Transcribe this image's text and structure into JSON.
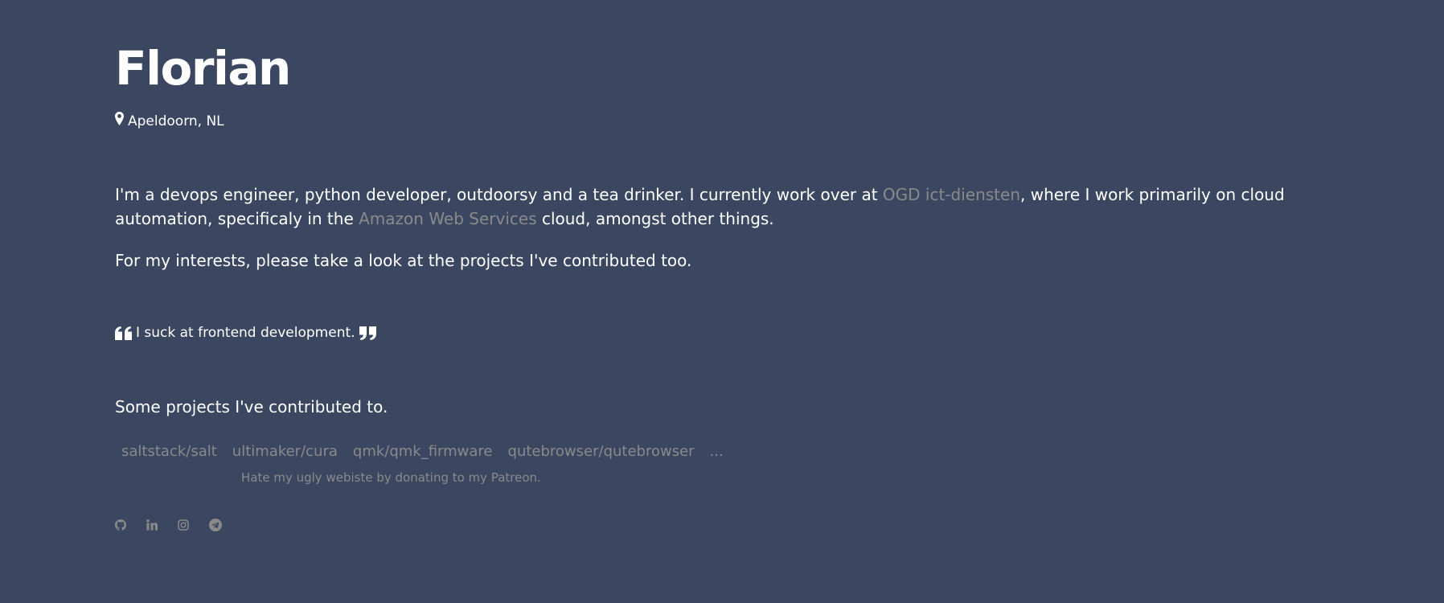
{
  "profile": {
    "name": "Florian",
    "location": "Apeldoorn, NL"
  },
  "intro": {
    "part1": "I'm a devops engineer, python developer, outdoorsy and a tea drinker. I currently work over at ",
    "employer_link": "OGD ict-diensten",
    "part2": ", where I work primarily on cloud automation, specificaly in the ",
    "cloud_link": "Amazon Web Services",
    "part3": " cloud, amongst other things.",
    "interests": "For my interests, please take a look at the projects I've contributed too."
  },
  "quote": {
    "text": "I suck at frontend development."
  },
  "projects": {
    "heading": "Some projects I've contributed to.",
    "items": [
      "saltstack/salt",
      "ultimaker/cura",
      "qmk/qmk_firmware",
      "qutebrowser/qutebrowser",
      "..."
    ]
  },
  "patreon": {
    "text": "Hate my ugly webiste by donating to my Patreon."
  },
  "social": {
    "icons": [
      "github-icon",
      "linkedin-icon",
      "instagram-icon",
      "telegram-icon"
    ]
  },
  "colors": {
    "background": "#3b4661",
    "text": "#ffffff",
    "link": "#8a8a8a"
  }
}
